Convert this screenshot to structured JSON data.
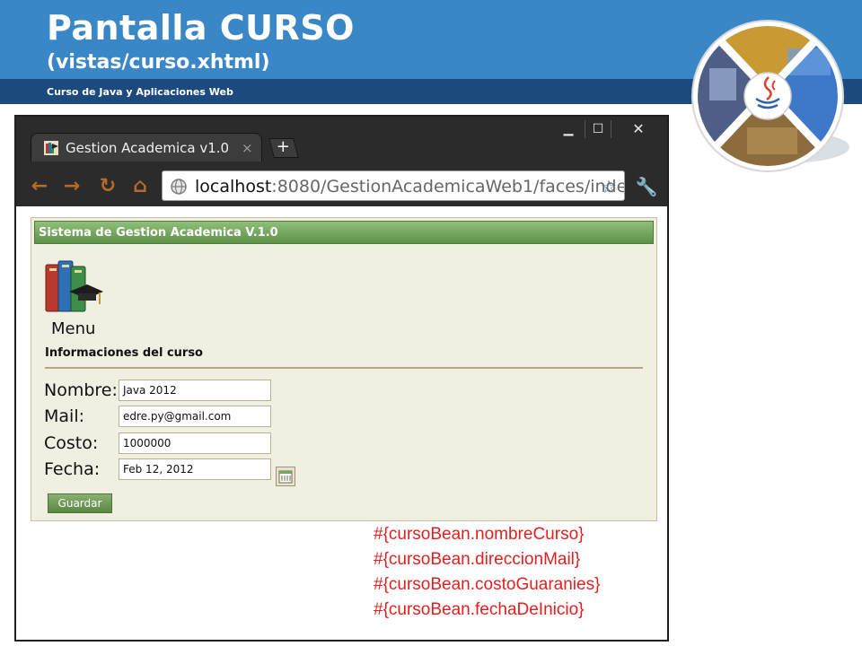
{
  "slide": {
    "title": "Pantalla CURSO",
    "subtitle": "(vistas/curso.xhtml)",
    "caption": "Curso de Java y Aplicaciones Web"
  },
  "browser": {
    "window_controls": {
      "minimize": "▁",
      "maximize": "☐",
      "close": "✕"
    },
    "tab": {
      "title": "Gestion Academica v1.0",
      "close_glyph": "×"
    },
    "new_tab_glyph": "+",
    "nav": {
      "back": "←",
      "forward": "→",
      "reload": "↻",
      "home": "⌂"
    },
    "address": {
      "host": "localhost",
      "path": ":8080/GestionAcademicaWeb1/faces/inde"
    },
    "bookmark_glyph": "☆",
    "menu_glyph": "🔧"
  },
  "app": {
    "header": "Sistema de Gestion Academica V.1.0",
    "menu_label": "Menu",
    "section_title": "Informaciones del curso",
    "fields": [
      {
        "label": "Nombre:",
        "value": "Java 2012"
      },
      {
        "label": "Mail:",
        "value": "edre.py@gmail.com"
      },
      {
        "label": "Costo:",
        "value": "1000000"
      },
      {
        "label": "Fecha:",
        "value": "Feb 12, 2012"
      }
    ],
    "save_label": "Guardar"
  },
  "bean_expressions": [
    "#{cursoBean.nombreCurso}",
    "#{cursoBean.direccionMail}",
    "#{cursoBean.costoGuaranies}",
    "#{cursoBean.fechaDeInicio}"
  ],
  "colors": {
    "header_blue": "#3a87c7",
    "header_navy": "#1d4a7d",
    "panel_bg": "#f1eee2",
    "panel_header_green": "#6e9e56",
    "expression_red": "#e02020"
  }
}
